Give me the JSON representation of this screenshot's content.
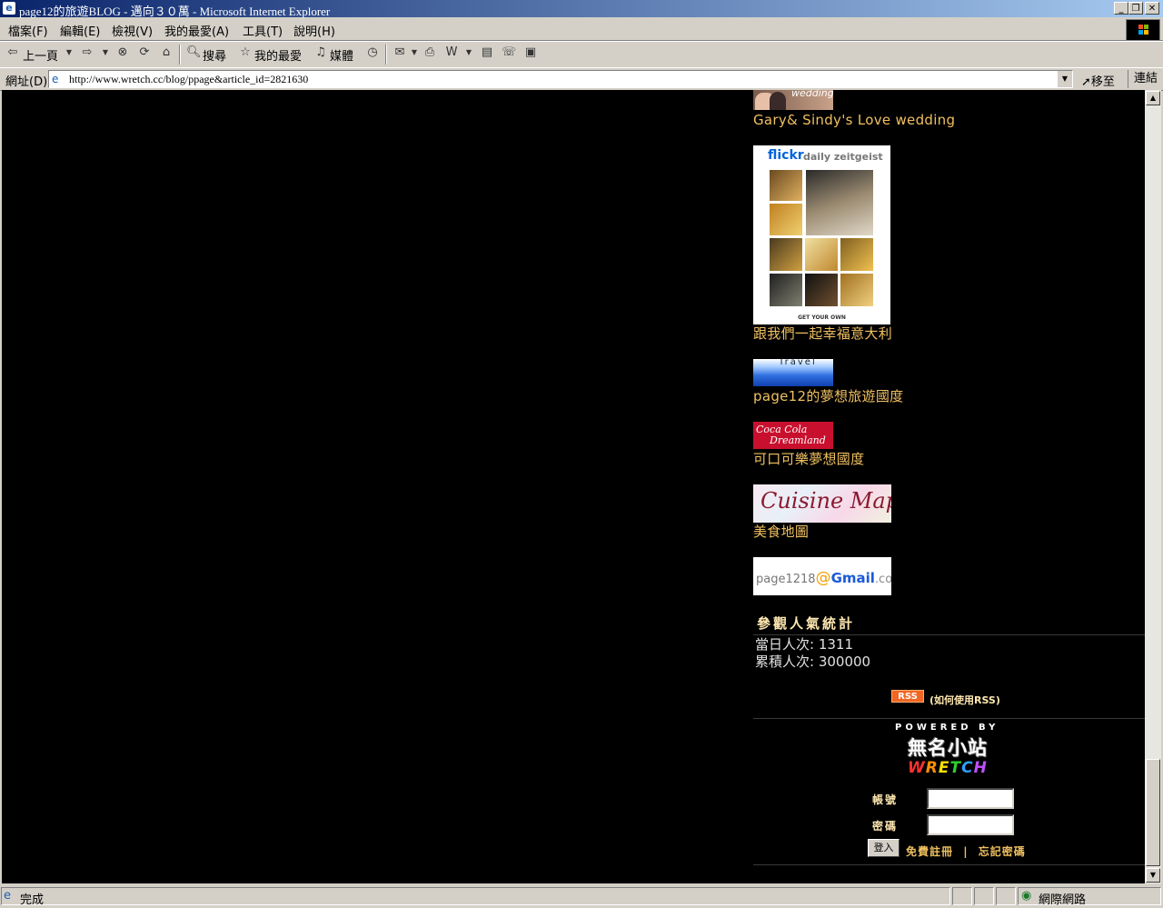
{
  "window": {
    "title": "page12的旅遊BLOG - 邁向３０萬 - Microsoft Internet Explorer"
  },
  "menu": [
    "檔案(F)",
    "編輯(E)",
    "檢視(V)",
    "我的最愛(A)",
    "工具(T)",
    "說明(H)"
  ],
  "toolbar": {
    "back": "上一頁",
    "search": "搜尋",
    "favorites": "我的最愛",
    "media": "媒體"
  },
  "address": {
    "label": "網址(D)",
    "url": "http://www.wretch.cc/blog/ppage&article_id=2821630",
    "go": "移至",
    "links": "連結"
  },
  "sidebar": {
    "links": [
      {
        "banner_text": "wedding",
        "label": "Gary& Sindy's Love wedding"
      },
      {
        "banner_brand": "flickr",
        "banner_sub": "daily zeitgeist",
        "banner_footer": "GET YOUR OWN",
        "label": "跟我們一起幸福意大利"
      },
      {
        "banner_text": "Travel",
        "label": "page12的夢想旅遊國度"
      },
      {
        "banner_line1": "Coca Cola",
        "banner_line2": "Dreamland",
        "label": "可口可樂夢想國度"
      },
      {
        "banner_text": "Cuisine Map",
        "label": "美食地圖"
      },
      {
        "banner_user": "page1218",
        "banner_at": "@",
        "banner_gmail": "Gmail",
        "banner_com": ".com"
      }
    ],
    "stats": {
      "title": "參觀人氣統計",
      "today": "當日人次: 1311",
      "total": "累積人次: 300000"
    },
    "rss": {
      "badge": "RSS",
      "help": "(如何使用RSS)"
    },
    "powered": {
      "label": "POWERED BY",
      "logo_cn": "無名小站",
      "logo_en": "WRETCH"
    },
    "login": {
      "account_label": "帳號",
      "password_label": "密碼",
      "button": "登入",
      "register": "免費註冊",
      "divider": "|",
      "forgot": "忘記密碼"
    }
  },
  "status": {
    "left": "完成",
    "zone": "網際網路"
  },
  "colors": {
    "page_bg": "#000000",
    "link": "#f0c060",
    "chrome": "#d4d0c8",
    "titlebar": "#0a246a"
  }
}
